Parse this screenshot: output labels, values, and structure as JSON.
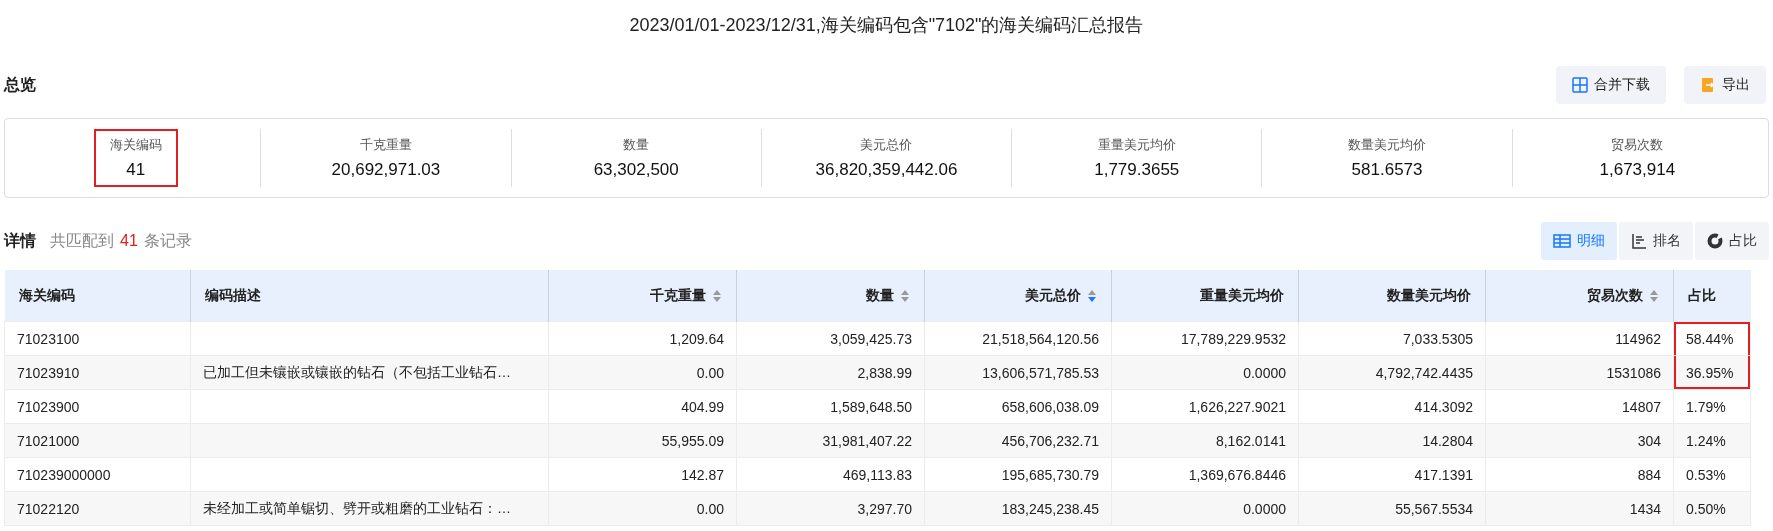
{
  "title": "2023/01/01-2023/12/31,海关编码包含\"7102\"的海关编码汇总报告",
  "overview": {
    "heading": "总览",
    "buttons": [
      {
        "kind": "merge",
        "label": "合并下载"
      },
      {
        "kind": "export",
        "label": "导出"
      }
    ],
    "stats": [
      {
        "label": "海关编码",
        "value": "41",
        "highlighted": true
      },
      {
        "label": "千克重量",
        "value": "20,692,971.03",
        "highlighted": false
      },
      {
        "label": "数量",
        "value": "63,302,500",
        "highlighted": false
      },
      {
        "label": "美元总价",
        "value": "36,820,359,442.06",
        "highlighted": false
      },
      {
        "label": "重量美元均价",
        "value": "1,779.3655",
        "highlighted": false
      },
      {
        "label": "数量美元均价",
        "value": "581.6573",
        "highlighted": false
      },
      {
        "label": "贸易次数",
        "value": "1,673,914",
        "highlighted": false
      }
    ]
  },
  "details": {
    "heading": "详情",
    "summary_prefix": "共匹配到",
    "count": "41",
    "summary_suffix": "条记录",
    "views": [
      {
        "kind": "table",
        "label": "明细",
        "selected": true
      },
      {
        "kind": "ranking",
        "label": "排名",
        "selected": false
      },
      {
        "kind": "donut",
        "label": "占比",
        "selected": false
      }
    ],
    "table": {
      "columns": [
        {
          "label": "海关编码",
          "kind": "text"
        },
        {
          "label": "编码描述",
          "kind": "text"
        },
        {
          "label": "千克重量",
          "kind": "number",
          "sorted": false
        },
        {
          "label": "数量",
          "kind": "number",
          "sorted": false
        },
        {
          "label": "美元总价",
          "kind": "number",
          "sorted": true
        },
        {
          "label": "重量美元均价",
          "kind": "number"
        },
        {
          "label": "数量美元均价",
          "kind": "number"
        },
        {
          "label": "贸易次数",
          "kind": "number",
          "sorted": false
        },
        {
          "label": "占比",
          "kind": "text"
        }
      ],
      "rows": [
        {
          "cells": [
            "71023100",
            "",
            "1,209.64",
            "3,059,425.73",
            "21,518,564,120.56",
            "17,789,229.9532",
            "7,033.5305",
            "114962",
            "58.44%"
          ],
          "highlighted": true
        },
        {
          "cells": [
            "71023910",
            "已加工但未镶嵌或镶嵌的钻石（不包括工业钻石…",
            "0.00",
            "2,838.99",
            "13,606,571,785.53",
            "0.0000",
            "4,792,742.4435",
            "1531086",
            "36.95%"
          ],
          "highlighted": true
        },
        {
          "cells": [
            "71023900",
            "",
            "404.99",
            "1,589,648.50",
            "658,606,038.09",
            "1,626,227.9021",
            "414.3092",
            "14807",
            "1.79%"
          ],
          "highlighted": false
        },
        {
          "cells": [
            "71021000",
            "",
            "55,955.09",
            "31,981,407.22",
            "456,706,232.71",
            "8,162.0141",
            "14.2804",
            "304",
            "1.24%"
          ],
          "highlighted": false
        },
        {
          "cells": [
            "710239000000",
            "",
            "142.87",
            "469,113.83",
            "195,685,730.79",
            "1,369,676.8446",
            "417.1391",
            "884",
            "0.53%"
          ],
          "highlighted": false
        },
        {
          "cells": [
            "71022120",
            "未经加工或简单锯切、劈开或粗磨的工业钻石：…",
            "0.00",
            "3,297.70",
            "183,245,238.45",
            "0.0000",
            "55,567.5534",
            "1434",
            "0.50%"
          ],
          "highlighted": false
        }
      ]
    }
  }
}
